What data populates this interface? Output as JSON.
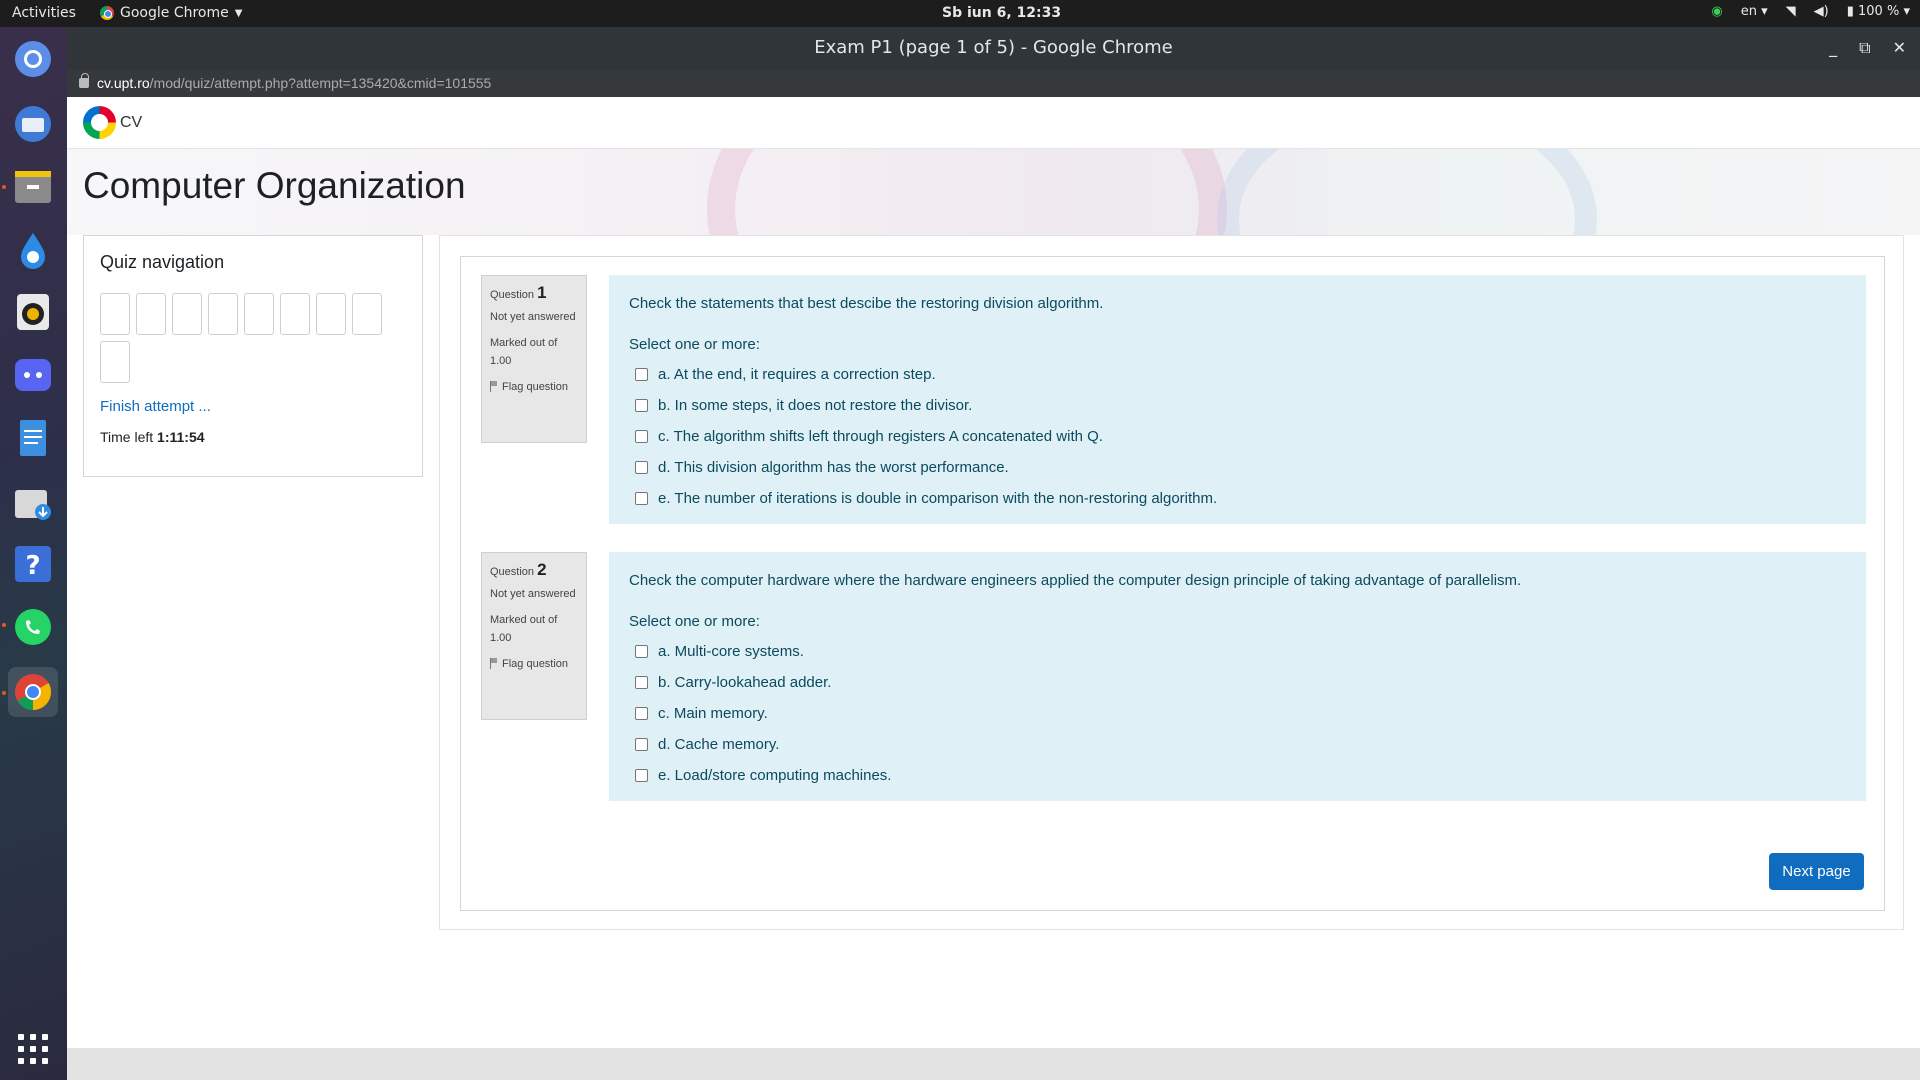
{
  "topbar": {
    "activities": "Activities",
    "app_menu": "Google Chrome",
    "clock": "Sb iun  6, 12:33",
    "lang": "en",
    "battery": "100 %"
  },
  "window": {
    "title": "Exam P1 (page 1 of 5) - Google Chrome",
    "url_host": "cv.upt.ro",
    "url_path": "/mod/quiz/attempt.php?attempt=135420&cmid=101555"
  },
  "site": {
    "name": "CV",
    "course_title": "Computer Organization"
  },
  "quiz_nav": {
    "title": "Quiz navigation",
    "finish_label": "Finish attempt ...",
    "time_left_label": "Time left ",
    "time_left_value": "1:11:54"
  },
  "questions": [
    {
      "label": "Question ",
      "number": "1",
      "state": "Not yet answered",
      "grade": "Marked out of 1.00",
      "flag": "Flag question",
      "text": "Check the statements that best descibe the restoring division algorithm.",
      "prompt": "Select one or more:",
      "options": [
        "a. At the end, it requires a correction step.",
        "b. In some steps, it does not restore the divisor.",
        "c. The algorithm shifts left through registers A concatenated with Q.",
        "d. This division algorithm has the worst performance.",
        "e. The number of iterations is double in comparison with the non-restoring algorithm."
      ]
    },
    {
      "label": "Question ",
      "number": "2",
      "state": "Not yet answered",
      "grade": "Marked out of 1.00",
      "flag": "Flag question",
      "text": "Check the computer hardware where the hardware engineers applied the computer design principle of taking advantage of parallelism.",
      "prompt": "Select one or more:",
      "options": [
        "a. Multi-core systems.",
        "b. Carry-lookahead adder.",
        "c. Main memory.",
        "d. Cache memory.",
        "e. Load/store computing machines."
      ]
    }
  ],
  "next_label": "Next page",
  "colors": {
    "accent": "#0f6cbf",
    "question_bg": "#dff0f6",
    "question_text": "#0b4a5f"
  }
}
